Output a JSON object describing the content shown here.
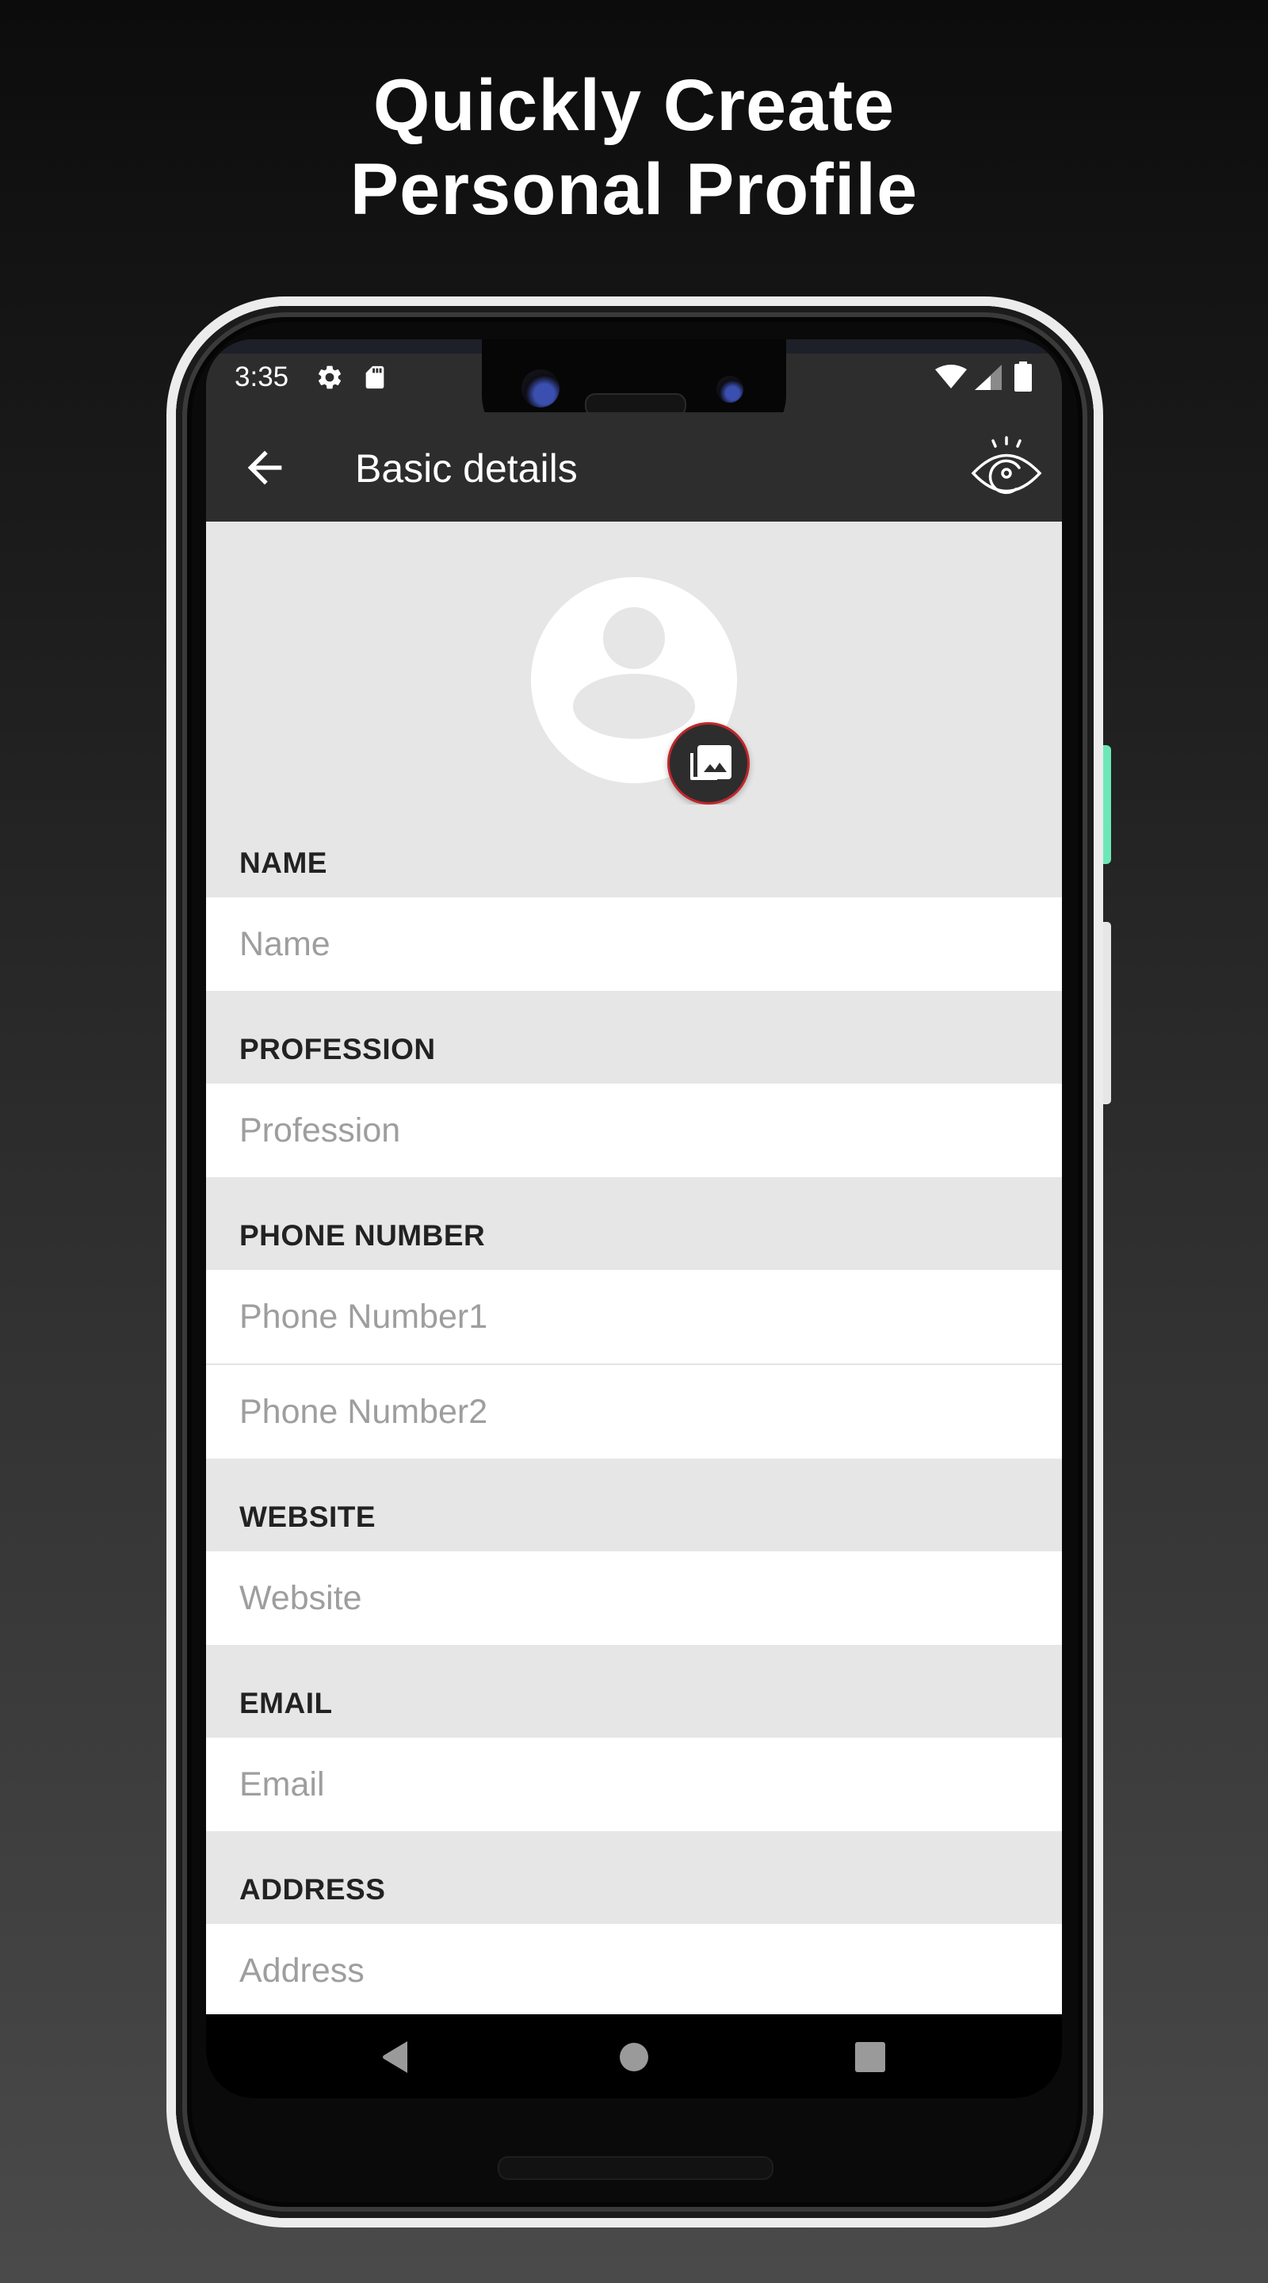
{
  "promo": {
    "title_line1": "Quickly Create",
    "title_line2": "Personal Profile"
  },
  "status_bar": {
    "time": "3:35",
    "left_icons": [
      "settings-icon",
      "sd-card-icon"
    ],
    "right_icons": [
      "wifi-icon",
      "cell-signal-icon",
      "battery-icon"
    ]
  },
  "app_bar": {
    "back_icon": "arrow-left-icon",
    "title": "Basic details",
    "preview_icon": "eye-icon"
  },
  "avatar": {
    "icon": "account-circle-icon",
    "photo_button_icon": "photo-library-icon",
    "photo_button_border_color": "#c0262b"
  },
  "form": {
    "sections": [
      {
        "label": "NAME",
        "fields": [
          {
            "placeholder": "Name",
            "value": ""
          }
        ]
      },
      {
        "label": "PROFESSION",
        "fields": [
          {
            "placeholder": "Profession",
            "value": ""
          }
        ]
      },
      {
        "label": "PHONE NUMBER",
        "fields": [
          {
            "placeholder": "Phone Number1",
            "value": ""
          },
          {
            "placeholder": "Phone Number2",
            "value": ""
          }
        ]
      },
      {
        "label": "WEBSITE",
        "fields": [
          {
            "placeholder": "Website",
            "value": ""
          }
        ]
      },
      {
        "label": "EMAIL",
        "fields": [
          {
            "placeholder": "Email",
            "value": ""
          }
        ]
      },
      {
        "label": "ADDRESS",
        "fields": [
          {
            "placeholder": "Address",
            "value": ""
          }
        ]
      }
    ]
  },
  "nav_bar": {
    "buttons": [
      "back-triangle-icon",
      "home-circle-icon",
      "recents-square-icon"
    ]
  },
  "colors": {
    "app_bar": "#2d2d2d",
    "section_bg": "#e6e6e6",
    "label_text": "#222222",
    "placeholder_text": "#9e9e9e",
    "side_button_accent": "#6ee7b7"
  }
}
